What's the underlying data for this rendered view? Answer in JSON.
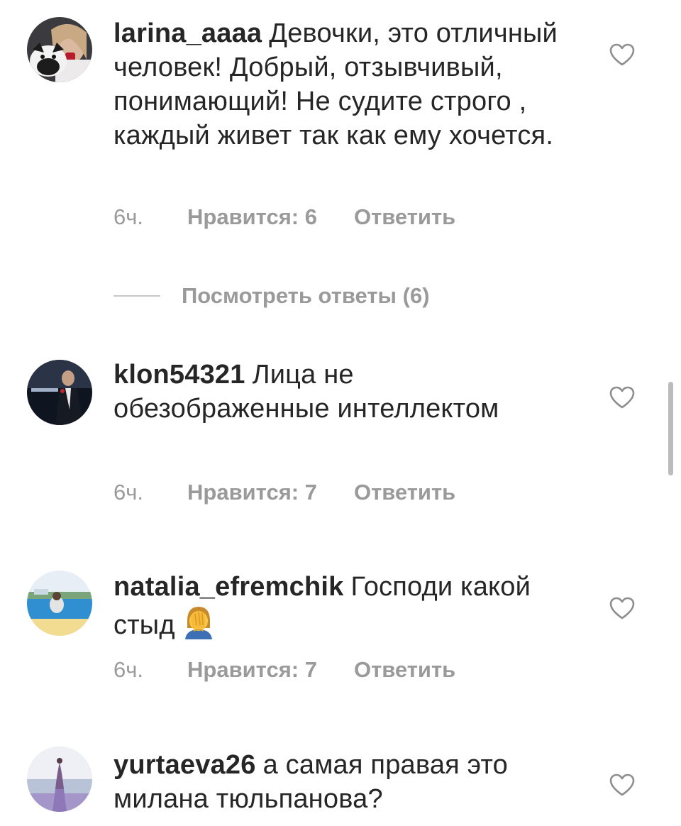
{
  "comments": [
    {
      "username": "larina_aaaa",
      "text": "Девочки, это отличный человек! Добрый, отзывчивый, понимающий! Не судите строго , каждый живет так как ему хочется.",
      "time": "6ч.",
      "likes": "Нравится: 6",
      "reply": "Ответить",
      "like_icon": "heart-outline-icon"
    },
    {
      "username": "klon54321",
      "text": "Лица не обезображенные интеллектом",
      "time": "6ч.",
      "likes": "Нравится: 7",
      "reply": "Ответить",
      "like_icon": "heart-outline-icon"
    },
    {
      "username": "natalia_efremchik",
      "text": "Господи какой стыд",
      "emoji": "face-palm-emoji",
      "time": "6ч.",
      "likes": "Нравится: 7",
      "reply": "Ответить",
      "like_icon": "heart-outline-icon"
    },
    {
      "username": "yurtaeva26",
      "text": "а самая правая это милана тюльпанова?",
      "like_icon": "heart-outline-icon"
    }
  ],
  "view_replies": "Посмотреть ответы (6)",
  "colors": {
    "text": "#262626",
    "meta": "#9a9a9a",
    "divider": "#c7c7c7",
    "scrollbar": "#bcbcbc"
  }
}
